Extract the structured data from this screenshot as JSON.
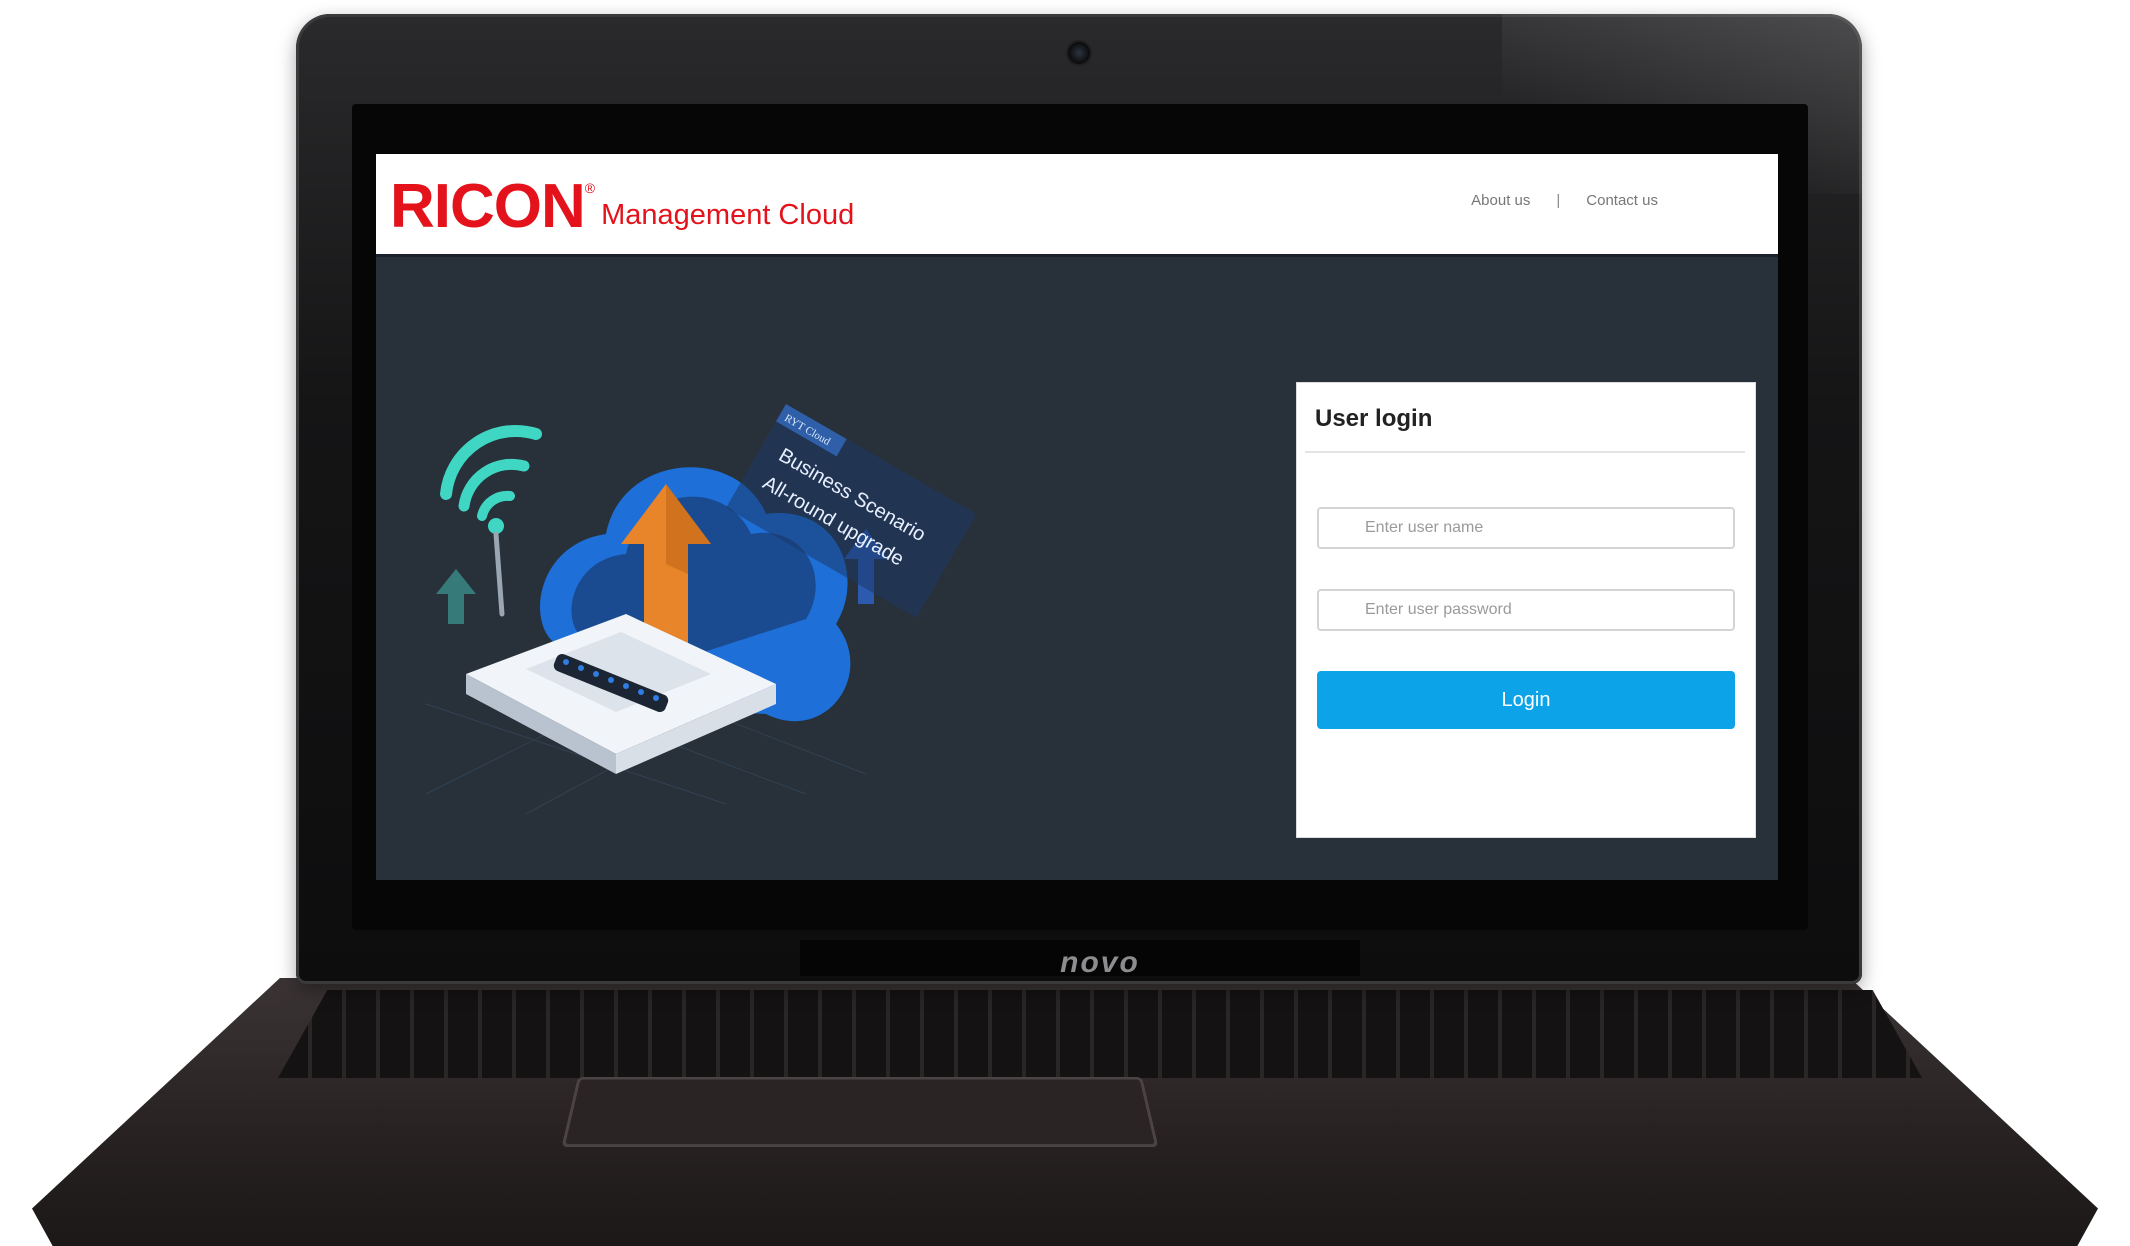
{
  "header": {
    "logo_main": "RICON",
    "logo_reg": "®",
    "logo_sub": "Management Cloud",
    "nav": {
      "about": "About us",
      "separator": "|",
      "contact": "Contact us"
    }
  },
  "illustration": {
    "badge": "RYT Cloud",
    "line1": "Business Scenario",
    "line2": "All-round upgrade",
    "icons": [
      "wifi-icon",
      "cloud-icon",
      "router-icon",
      "upload-arrow-icon"
    ]
  },
  "login": {
    "title": "User login",
    "username_placeholder": "Enter user name",
    "password_placeholder": "Enter user password",
    "button_label": "Login"
  },
  "laptop": {
    "brand": "novo"
  },
  "colors": {
    "brand_red": "#e3121b",
    "screen_bg": "#283039",
    "button_blue": "#0da3e8",
    "cloud_blue": "#1e6fd8",
    "wifi_teal": "#3fd6c4",
    "arrow_orange": "#e8842a"
  }
}
